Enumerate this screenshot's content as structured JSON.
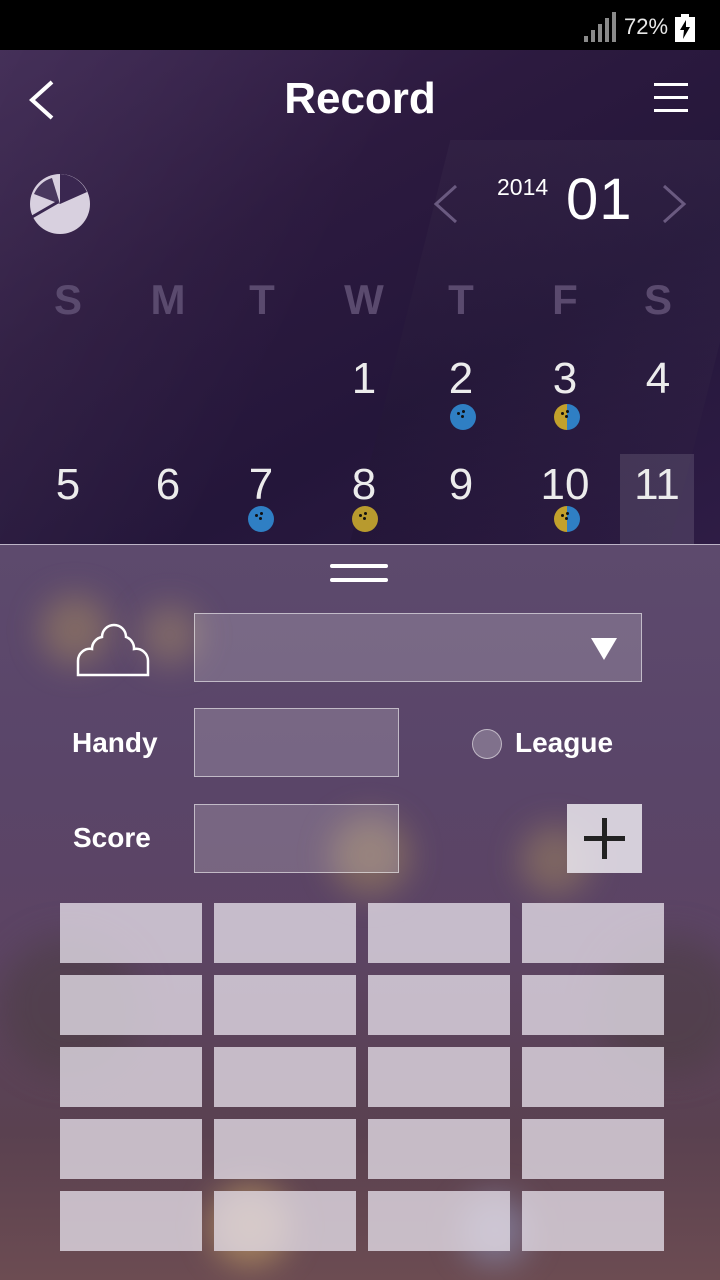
{
  "status_bar": {
    "battery_percent": "72%",
    "signal_icon": "signal-bars-icon",
    "battery_icon": "battery-charging-icon"
  },
  "header": {
    "title": "Record",
    "back_icon": "chevron-left-icon",
    "menu_icon": "hamburger-menu-icon",
    "stats_icon": "pie-chart-icon"
  },
  "calendar": {
    "year": "2014",
    "month": "01",
    "prev_icon": "chevron-left-icon",
    "next_icon": "chevron-right-icon",
    "weekdays": [
      "S",
      "M",
      "T",
      "W",
      "T",
      "F",
      "S"
    ],
    "week1": [
      "1",
      "2",
      "3",
      "4"
    ],
    "week2": [
      "5",
      "6",
      "7",
      "8",
      "9",
      "10",
      "11"
    ],
    "selected_day": "11",
    "ball_colors": {
      "blue": "#2f7fc4",
      "gold": "#b89a2e"
    }
  },
  "form": {
    "group_icon": "group-icon",
    "group_select_value": "",
    "handy_label": "Handy",
    "handy_value": "",
    "league_label": "League",
    "league_selected": false,
    "score_label": "Score",
    "score_value": "",
    "add_icon": "plus-icon"
  },
  "score_grid": {
    "rows": 5,
    "columns": 4
  }
}
